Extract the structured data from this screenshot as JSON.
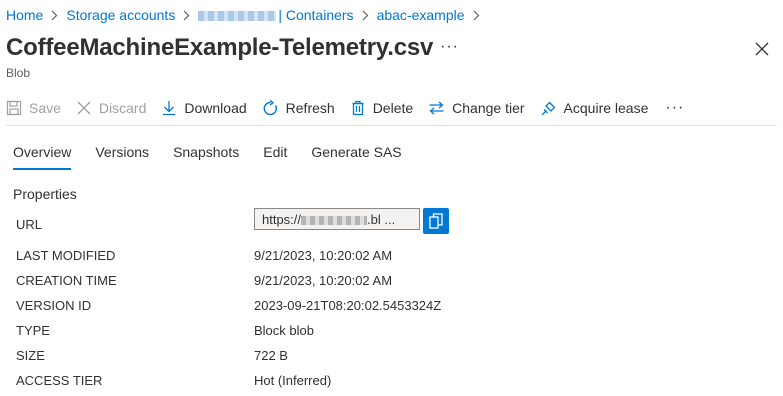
{
  "breadcrumb": {
    "home": "Home",
    "storage_accounts": "Storage accounts",
    "containers": "| Containers",
    "container": "abac-example"
  },
  "page": {
    "title": "CoffeeMachineExample-Telemetry.csv",
    "subtitle": "Blob",
    "more": "···"
  },
  "toolbar": {
    "save": "Save",
    "discard": "Discard",
    "download": "Download",
    "refresh": "Refresh",
    "delete": "Delete",
    "change_tier": "Change tier",
    "acquire_lease": "Acquire lease",
    "more": "···"
  },
  "tabs": [
    "Overview",
    "Versions",
    "Snapshots",
    "Edit",
    "Generate SAS"
  ],
  "properties": {
    "heading": "Properties",
    "url_label": "URL",
    "url_prefix": "https://",
    "url_suffix": ".bl ...",
    "items": [
      {
        "label": "LAST MODIFIED",
        "value": "9/21/2023, 10:20:02 AM"
      },
      {
        "label": "CREATION TIME",
        "value": "9/21/2023, 10:20:02 AM"
      },
      {
        "label": "VERSION ID",
        "value": "2023-09-21T08:20:02.5453324Z"
      },
      {
        "label": "TYPE",
        "value": "Block blob"
      },
      {
        "label": "SIZE",
        "value": "722 B"
      },
      {
        "label": "ACCESS TIER",
        "value": "Hot (Inferred)"
      }
    ]
  },
  "colors": {
    "accent": "#0078d4",
    "text": "#323130",
    "disabled": "#a19f9d"
  },
  "icons": [
    "chevron-right-icon",
    "close-icon",
    "save-icon",
    "discard-icon",
    "download-icon",
    "refresh-icon",
    "delete-icon",
    "change-tier-icon",
    "acquire-lease-icon",
    "copy-icon"
  ]
}
